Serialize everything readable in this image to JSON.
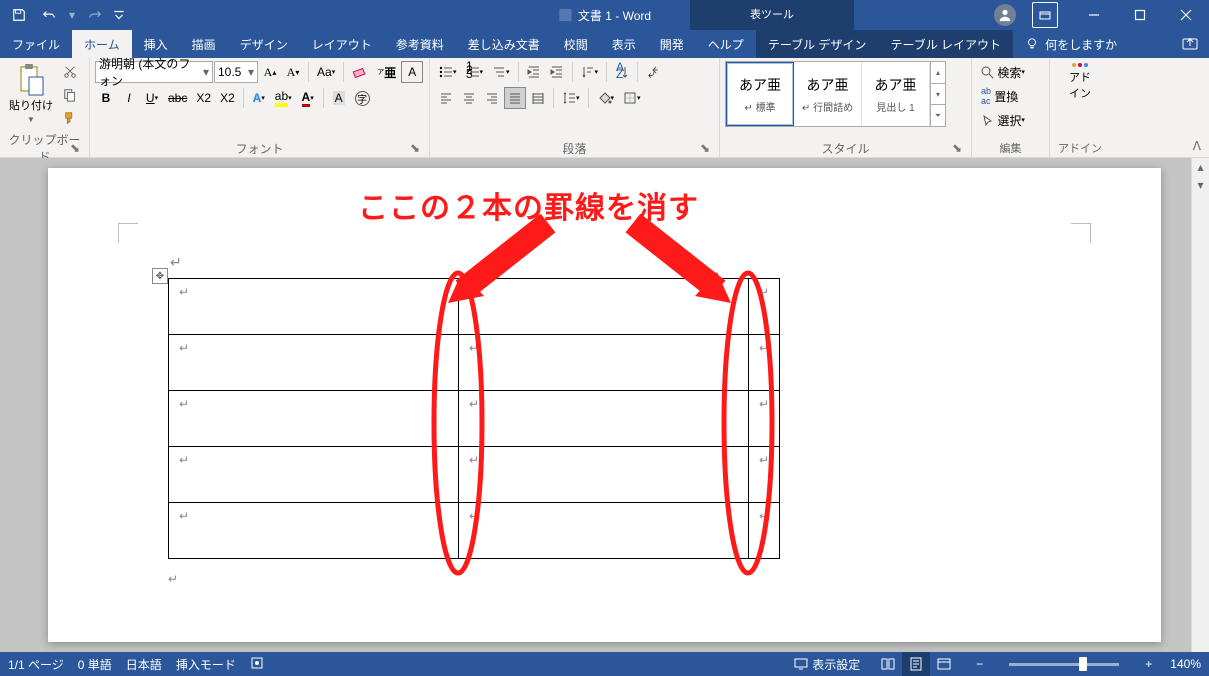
{
  "app": {
    "title": "文書 1 - Word",
    "context_tool": "表ツール"
  },
  "tabs": {
    "file": "ファイル",
    "home": "ホーム",
    "insert": "挿入",
    "draw": "描画",
    "design": "デザイン",
    "layout": "レイアウト",
    "references": "参考資料",
    "mailings": "差し込み文書",
    "review": "校閲",
    "view": "表示",
    "developer": "開発",
    "help": "ヘルプ",
    "table_design": "テーブル デザイン",
    "table_layout": "テーブル レイアウト",
    "tell_me": "何をしますか"
  },
  "ribbon": {
    "clipboard": {
      "label": "クリップボード",
      "paste": "貼り付け"
    },
    "font": {
      "label": "フォント",
      "name": "游明朝 (本文のフォン",
      "size": "10.5"
    },
    "paragraph": {
      "label": "段落"
    },
    "styles": {
      "label": "スタイル",
      "items": [
        {
          "preview": "あア亜",
          "name": "↵ 標準"
        },
        {
          "preview": "あア亜",
          "name": "↵ 行間詰め"
        },
        {
          "preview": "あア亜",
          "name": "見出し 1"
        }
      ]
    },
    "editing": {
      "label": "編集",
      "find": "検索",
      "replace": "置換",
      "select": "選択"
    },
    "addins": {
      "label": "アドイン",
      "btn": "アド\nイン"
    }
  },
  "annotation": {
    "text": "ここの２本の罫線を消す"
  },
  "status": {
    "page": "1/1 ページ",
    "words": "0 単語",
    "lang": "日本語",
    "mode": "挿入モード",
    "display": "表示設定",
    "zoom": "140%"
  }
}
